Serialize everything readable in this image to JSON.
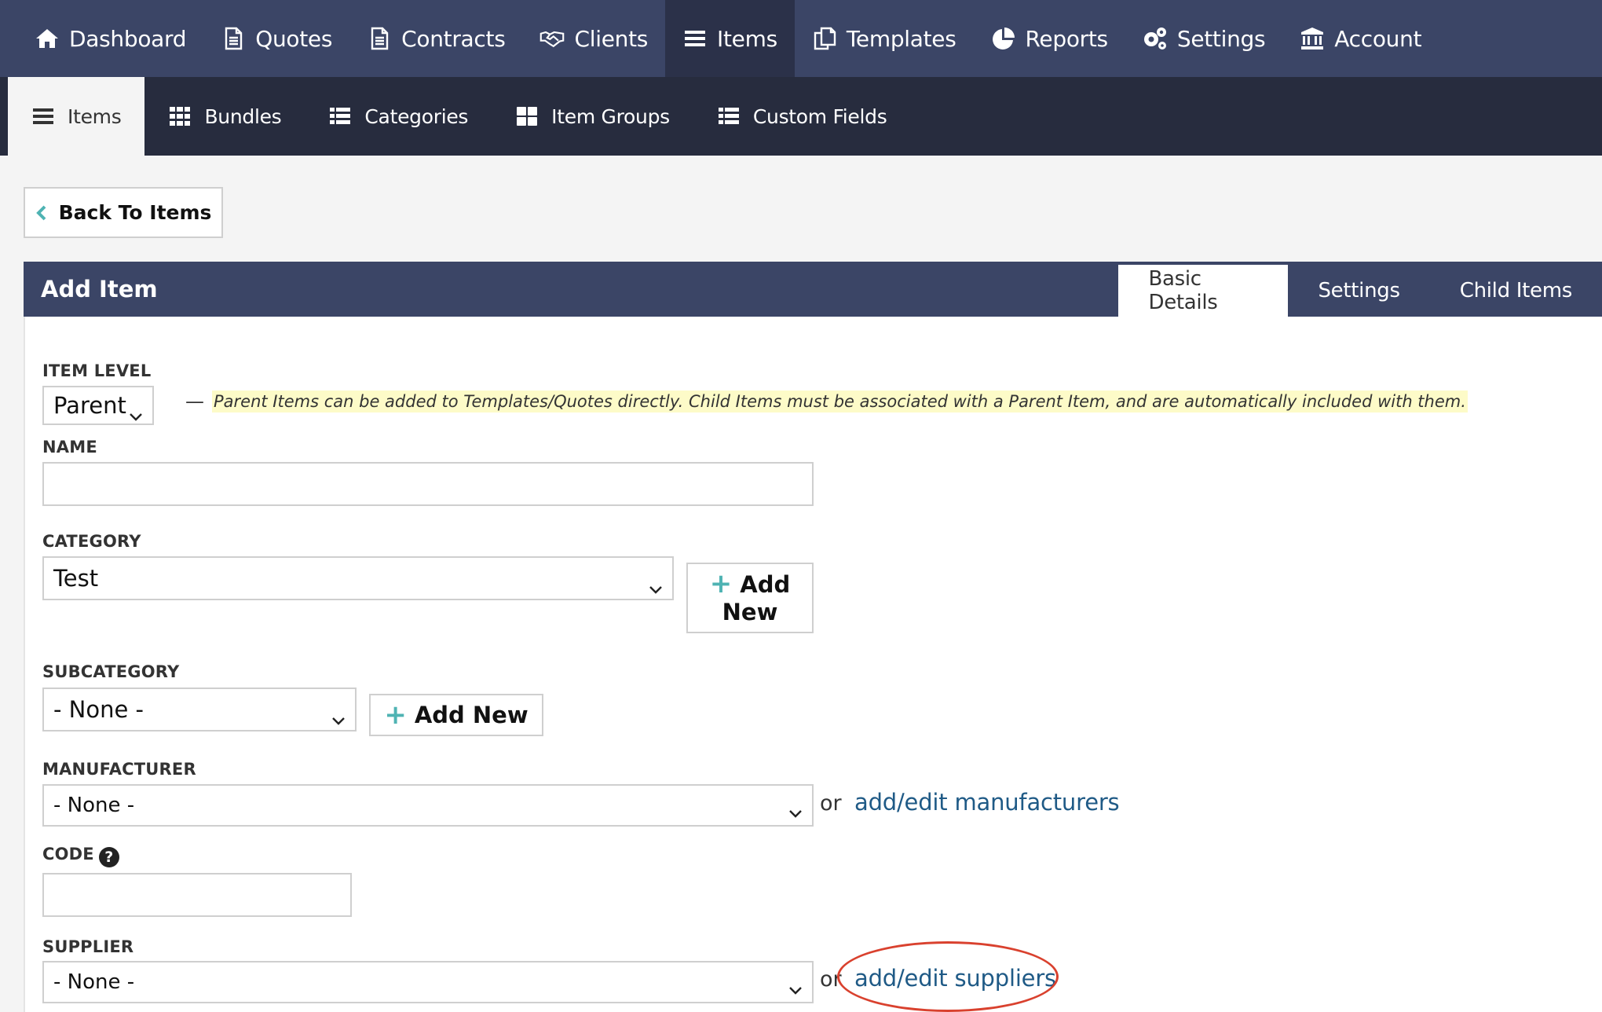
{
  "topnav": {
    "items": [
      {
        "label": "Dashboard",
        "icon": "home-icon"
      },
      {
        "label": "Quotes",
        "icon": "document-icon"
      },
      {
        "label": "Contracts",
        "icon": "document-icon"
      },
      {
        "label": "Clients",
        "icon": "handshake-icon"
      },
      {
        "label": "Items",
        "icon": "list-icon"
      },
      {
        "label": "Templates",
        "icon": "copy-icon"
      },
      {
        "label": "Reports",
        "icon": "pie-chart-icon"
      },
      {
        "label": "Settings",
        "icon": "gears-icon"
      },
      {
        "label": "Account",
        "icon": "bank-icon"
      }
    ],
    "active": "Items"
  },
  "subnav": {
    "items": [
      {
        "label": "Items",
        "icon": "list-icon"
      },
      {
        "label": "Bundles",
        "icon": "grid-icon"
      },
      {
        "label": "Categories",
        "icon": "list-bullets-icon"
      },
      {
        "label": "Item Groups",
        "icon": "tiles-icon"
      },
      {
        "label": "Custom Fields",
        "icon": "list-bullets-icon"
      }
    ],
    "active": "Items"
  },
  "back_button": {
    "label": "Back To Items"
  },
  "panel": {
    "title": "Add Item",
    "tabs": [
      "Basic Details",
      "Settings",
      "Child Items"
    ],
    "active_tab": "Basic Details"
  },
  "form": {
    "item_level": {
      "label": "ITEM LEVEL",
      "value": "Parent",
      "dash": "—",
      "hint": "Parent Items can be added to Templates/Quotes directly. Child Items must be associated with a Parent Item, and are automatically included with them."
    },
    "name": {
      "label": "NAME",
      "value": ""
    },
    "category": {
      "label": "CATEGORY",
      "value": "Test",
      "add_line1": "Add",
      "add_line2": "New"
    },
    "subcategory": {
      "label": "SUBCATEGORY",
      "value": "- None -",
      "add_label": "Add New"
    },
    "manufacturer": {
      "label": "MANUFACTURER",
      "value": "- None -",
      "or": "or",
      "link": "add/edit manufacturers"
    },
    "code": {
      "label": "CODE",
      "help": "?",
      "value": ""
    },
    "supplier": {
      "label": "SUPPLIER",
      "value": "- None -",
      "or": "or",
      "link": "add/edit suppliers"
    }
  },
  "colors": {
    "topnav_bg": "#3b4566",
    "topnav_active": "#2b3149",
    "subnav_bg": "#272c3e",
    "accent": "#4fb3b3",
    "link": "#1f5a86",
    "hint_bg": "#fdfbc8",
    "annotation": "#d9412e"
  }
}
